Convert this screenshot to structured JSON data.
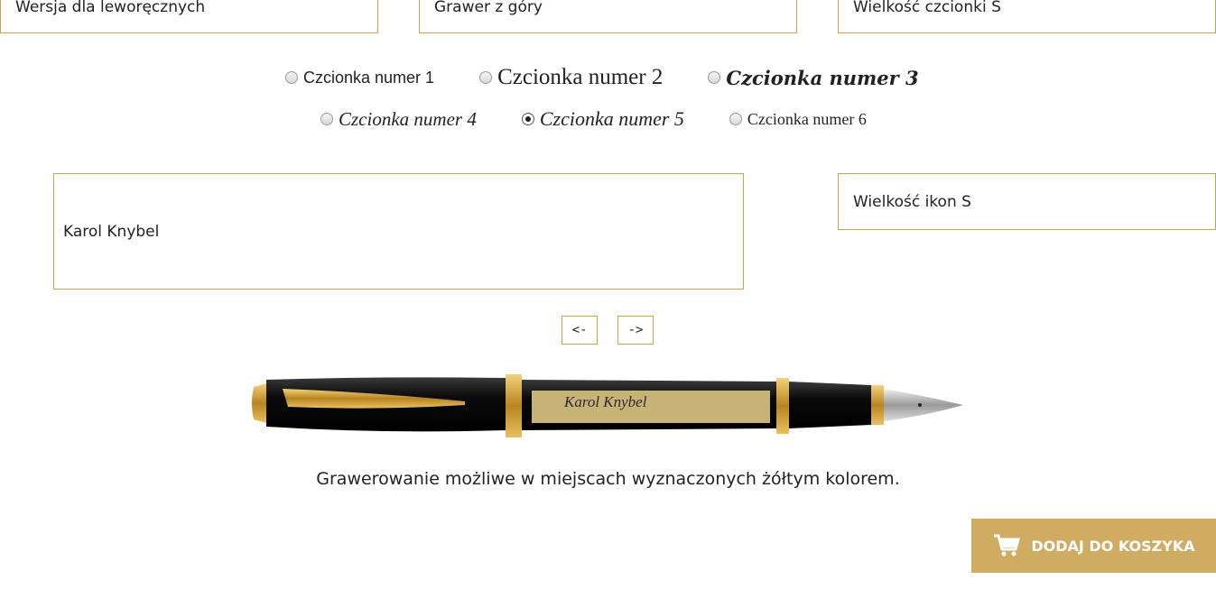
{
  "options": {
    "left_handed": "Wersja dla leworęcznych",
    "top_engraving": "Grawer z góry",
    "font_size": "Wielkość czcionki S",
    "icon_size": "Wielkość ikon S"
  },
  "fonts": [
    {
      "label": "Czcionka numer 1",
      "checked": false
    },
    {
      "label": "Czcionka numer 2",
      "checked": false
    },
    {
      "label": "Czcionka numer 3",
      "checked": false
    },
    {
      "label": "Czcionka numer 4",
      "checked": false
    },
    {
      "label": "Czcionka numer 5",
      "checked": true
    },
    {
      "label": "Czcionka numer 6",
      "checked": false
    }
  ],
  "engraving_text": "Karol Knybel",
  "nav": {
    "prev": "<-",
    "next": "->"
  },
  "pen": {
    "engraving_preview": "Karol Knybel"
  },
  "caption": "Grawerowanie możliwe w miejscach wyznaczonych żółtym kolorem.",
  "cart": {
    "label": "DODAJ DO KOSZYKA",
    "icon": "cart-icon",
    "color": "#d0ab62"
  },
  "colors": {
    "accent": "#c9a24a"
  }
}
